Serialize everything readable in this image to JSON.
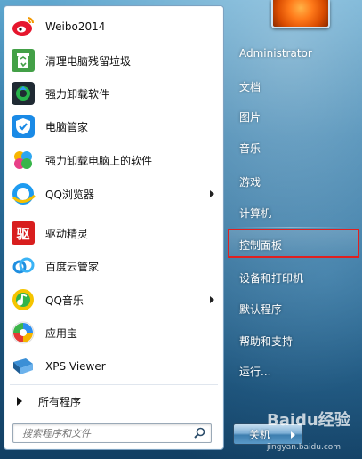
{
  "start_menu": {
    "left": {
      "items": [
        {
          "label": "Weibo2014",
          "icon": "weibo-icon",
          "arrow": false
        },
        {
          "label": "清理电脑残留垃圾",
          "icon": "recycle-icon",
          "arrow": false
        },
        {
          "label": "强力卸载软件",
          "icon": "uninstall-icon",
          "arrow": false
        },
        {
          "label": "电脑管家",
          "icon": "shield-icon",
          "arrow": false
        },
        {
          "label": "强力卸载电脑上的软件",
          "icon": "clover-icon",
          "arrow": false
        },
        {
          "label": "QQ浏览器",
          "icon": "qq-browser-icon",
          "arrow": true
        },
        {
          "label": "驱动精灵",
          "icon": "driver-icon",
          "arrow": false
        },
        {
          "label": "百度云管家",
          "icon": "cloud-icon",
          "arrow": false
        },
        {
          "label": "QQ音乐",
          "icon": "music-icon",
          "arrow": true
        },
        {
          "label": "应用宝",
          "icon": "app-store-icon",
          "arrow": false
        },
        {
          "label": "XPS Viewer",
          "icon": "xps-viewer-icon",
          "arrow": false
        }
      ],
      "all_programs": "所有程序",
      "search_placeholder": "搜索程序和文件"
    },
    "right": {
      "user": "Administrator",
      "items": [
        "文档",
        "图片",
        "音乐",
        "游戏",
        "计算机",
        "控制面板",
        "设备和打印机",
        "默认程序",
        "帮助和支持",
        "运行..."
      ],
      "highlighted": "控制面板",
      "shutdown": "关机"
    },
    "watermark": {
      "logo": "Baidu经验",
      "url": "jingyan.baidu.com"
    },
    "colors": {
      "highlight_border": "#e02020",
      "panel_bg": "#ffffff",
      "glass": "#2f77a5"
    }
  }
}
